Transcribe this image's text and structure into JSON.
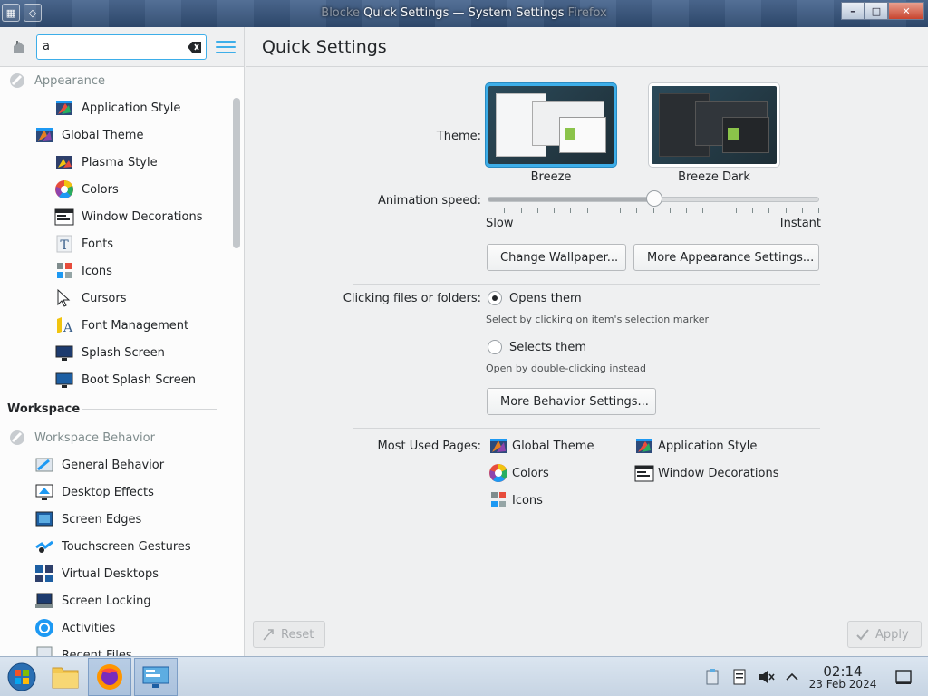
{
  "window": {
    "title_ghost": "Blocke",
    "title": "Quick Settings — System Settings",
    "title_ghost_right": "Firefox",
    "buttons": {
      "minimize": "–",
      "maximize": "□",
      "close": "✕"
    }
  },
  "search": {
    "value": "a",
    "placeholder": ""
  },
  "sidebar": {
    "appearance_label": "Appearance",
    "items": [
      {
        "label": "Application Style",
        "level": 2,
        "icon": "application-style-icon"
      },
      {
        "label": "Global Theme",
        "level": 1,
        "icon": "global-theme-icon"
      },
      {
        "label": "Plasma Style",
        "level": 2,
        "icon": "plasma-style-icon"
      },
      {
        "label": "Colors",
        "level": 2,
        "icon": "colors-icon"
      },
      {
        "label": "Window Decorations",
        "level": 2,
        "icon": "window-decorations-icon"
      },
      {
        "label": "Fonts",
        "level": 2,
        "icon": "fonts-icon"
      },
      {
        "label": "Icons",
        "level": 2,
        "icon": "icons-icon"
      },
      {
        "label": "Cursors",
        "level": 2,
        "icon": "cursors-icon"
      },
      {
        "label": "Font Management",
        "level": 2,
        "icon": "font-management-icon"
      },
      {
        "label": "Splash Screen",
        "level": 2,
        "icon": "splash-screen-icon"
      },
      {
        "label": "Boot Splash Screen",
        "level": 2,
        "icon": "boot-splash-screen-icon"
      }
    ],
    "workspace_section": "Workspace",
    "workspace_behavior_label": "Workspace Behavior",
    "workspace_items": [
      {
        "label": "General Behavior",
        "icon": "general-behavior-icon"
      },
      {
        "label": "Desktop Effects",
        "icon": "desktop-effects-icon"
      },
      {
        "label": "Screen Edges",
        "icon": "screen-edges-icon"
      },
      {
        "label": "Touchscreen Gestures",
        "icon": "touchscreen-gestures-icon"
      },
      {
        "label": "Virtual Desktops",
        "icon": "virtual-desktops-icon"
      },
      {
        "label": "Screen Locking",
        "icon": "screen-locking-icon"
      },
      {
        "label": "Activities",
        "icon": "activities-icon"
      },
      {
        "label": "Recent Files",
        "icon": "recent-files-icon"
      }
    ]
  },
  "main": {
    "title": "Quick Settings",
    "theme_label": "Theme:",
    "themes": [
      {
        "name": "Breeze",
        "selected": true
      },
      {
        "name": "Breeze Dark",
        "selected": false
      }
    ],
    "animation_label": "Animation speed:",
    "animation_value": 0.5,
    "slow_label": "Slow",
    "instant_label": "Instant",
    "change_wallpaper": "Change Wallpaper...",
    "more_appearance": "More Appearance Settings...",
    "clicking_label": "Clicking files or folders:",
    "opens_them": "Opens them",
    "opens_hint": "Select by clicking on item's selection marker",
    "selects_them": "Selects them",
    "selects_hint": "Open by double-clicking instead",
    "more_behavior": "More Behavior Settings...",
    "most_used_label": "Most Used Pages:",
    "most_used": [
      "Global Theme",
      "Application Style",
      "Colors",
      "Window Decorations",
      "Icons"
    ],
    "reset": "Reset",
    "apply": "Apply"
  },
  "taskbar": {
    "time": "02:14",
    "date": "23 Feb 2024"
  },
  "colors": {
    "accent": "#3daee9",
    "selection": "#3daee9"
  }
}
